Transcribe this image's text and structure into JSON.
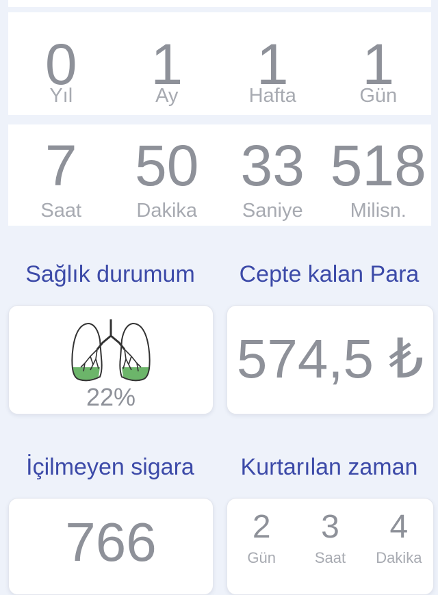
{
  "counter_top": [
    {
      "value": "0",
      "unit": "Yıl"
    },
    {
      "value": "1",
      "unit": "Ay"
    },
    {
      "value": "1",
      "unit": "Hafta"
    },
    {
      "value": "1",
      "unit": "Gün"
    }
  ],
  "counter_bottom": [
    {
      "value": "7",
      "unit": "Saat"
    },
    {
      "value": "50",
      "unit": "Dakika"
    },
    {
      "value": "33",
      "unit": "Saniye"
    },
    {
      "value": "518",
      "unit": "Milisn."
    }
  ],
  "health": {
    "title": "Sağlık durumum",
    "percent_text": "22%",
    "percent_value": 0.22,
    "icon": "lungs-icon"
  },
  "money": {
    "title": "Cepte kalan Para",
    "value": "574,5 ₺"
  },
  "cigarettes": {
    "title": "İçilmeyen sigara",
    "value": "766"
  },
  "saved_time": {
    "title": "Kurtarılan zaman",
    "items": [
      {
        "value": "2",
        "unit": "Gün"
      },
      {
        "value": "3",
        "unit": "Saat"
      },
      {
        "value": "4",
        "unit": "Dakika"
      }
    ]
  },
  "colors": {
    "background": "#eef2fa",
    "title_blue": "#3c4aa8",
    "number_gray": "#8e9199",
    "lung_fill": "#6cb56a"
  }
}
